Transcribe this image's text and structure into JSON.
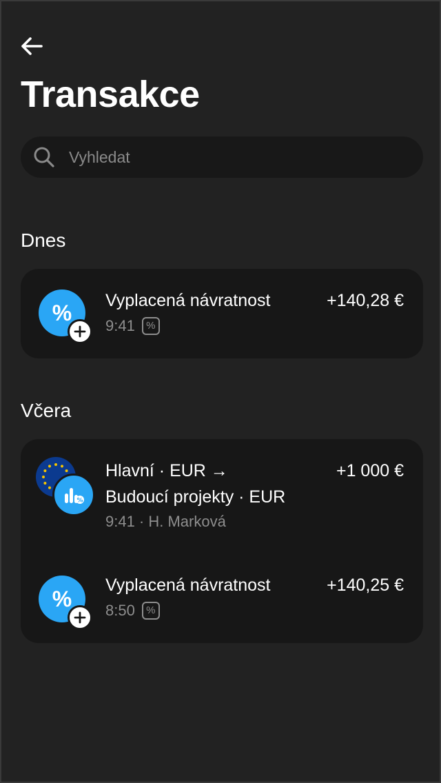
{
  "header": {
    "back_icon": "arrow-left-icon",
    "title": "Transakce"
  },
  "search": {
    "placeholder": "Vyhledat",
    "icon": "search-icon"
  },
  "sections": [
    {
      "title": "Dnes",
      "transactions": [
        {
          "name": "Vyplacená návratnost",
          "time": "9:41",
          "amount": "+140,28 €",
          "avatar_symbol": "%",
          "tag": "%"
        }
      ]
    },
    {
      "title": "Včera",
      "transactions": [
        {
          "name_line1": "Hlavní · EUR →",
          "name_line2": "Budoucí projekty · EUR",
          "sub": "9:41 · H. Marková",
          "amount": "+1 000 €"
        },
        {
          "name": "Vyplacená návratnost",
          "time": "8:50",
          "amount": "+140,25 €",
          "avatar_symbol": "%",
          "tag": "%"
        }
      ]
    }
  ],
  "colors": {
    "background": "#222222",
    "card": "#171717",
    "accent_blue": "#2aa6f5",
    "eu_blue": "#0b3a8f",
    "eu_star": "#f5c400",
    "muted_text": "#8e8e8e"
  }
}
